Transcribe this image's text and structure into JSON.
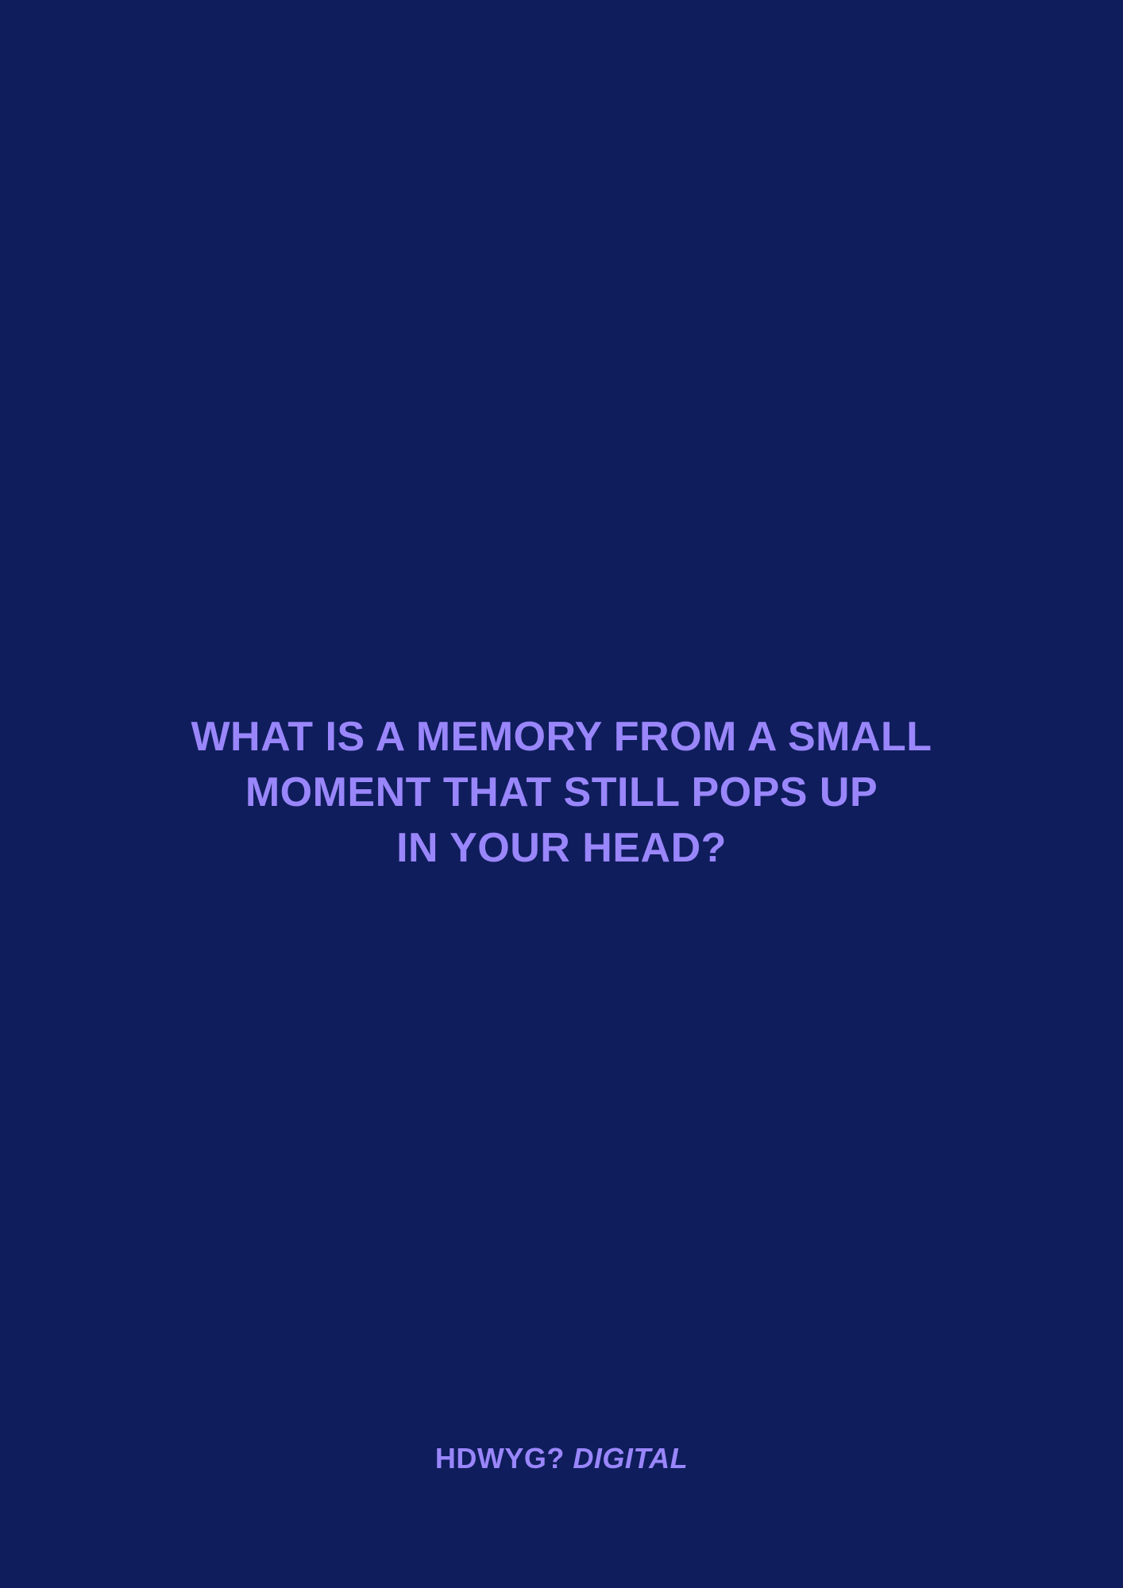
{
  "colors": {
    "background": "#0f1d5c",
    "accent_text": "#9a86fb"
  },
  "question": {
    "lines": [
      "WHAT IS A MEMORY FROM A SMALL",
      "MOMENT THAT STILL POPS UP",
      "IN YOUR HEAD?"
    ]
  },
  "brand": {
    "name": "HDWYG?",
    "suffix": "DIGITAL"
  }
}
